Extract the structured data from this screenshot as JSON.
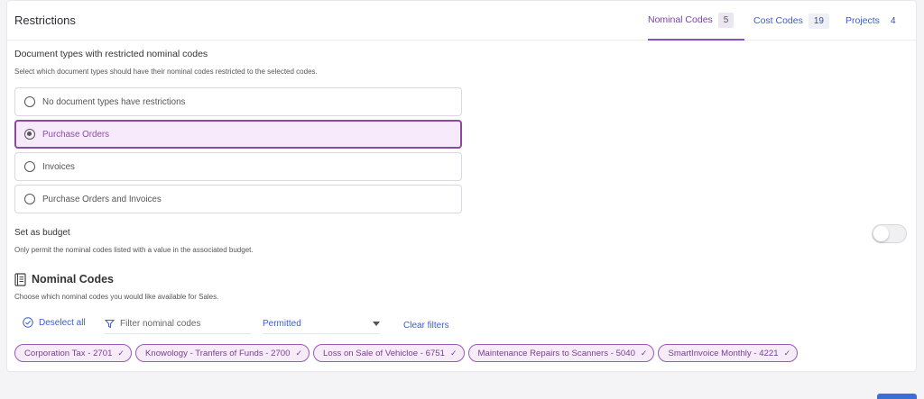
{
  "header": {
    "title": "Restrictions",
    "tabs": [
      {
        "label": "Nominal Codes",
        "count": "5"
      },
      {
        "label": "Cost Codes",
        "count": "19"
      },
      {
        "label": "Projects",
        "count": "4"
      }
    ]
  },
  "doc_types": {
    "title": "Document types with restricted nominal codes",
    "description": "Select which document types should have their nominal codes restricted to the selected codes.",
    "options": [
      {
        "label": "No document types have restrictions"
      },
      {
        "label": "Purchase Orders"
      },
      {
        "label": "Invoices"
      },
      {
        "label": "Purchase Orders and Invoices"
      }
    ],
    "selected": "Purchase Orders"
  },
  "budget": {
    "title": "Set as budget",
    "description": "Only permit the nominal codes listed with a value in the associated budget."
  },
  "nominal_codes": {
    "title": "Nominal Codes",
    "description": "Choose which nominal codes you would like available for Sales.",
    "deselect_label": "Deselect all",
    "filter_placeholder": "Filter nominal codes",
    "status_value": "Permitted",
    "clear_label": "Clear filters",
    "chips": [
      {
        "label": "Corporation Tax - 2701"
      },
      {
        "label": "Knowology - Tranfers of Funds - 2700"
      },
      {
        "label": "Loss on Sale of Vehicloe - 6751"
      },
      {
        "label": "Maintenance Repairs to Scanners - 5040"
      },
      {
        "label": "SmartInvoice Monthly - 4221"
      }
    ]
  },
  "colors": {
    "accent_purple": "#8a4fc0",
    "link_blue": "#3b5bdb"
  }
}
